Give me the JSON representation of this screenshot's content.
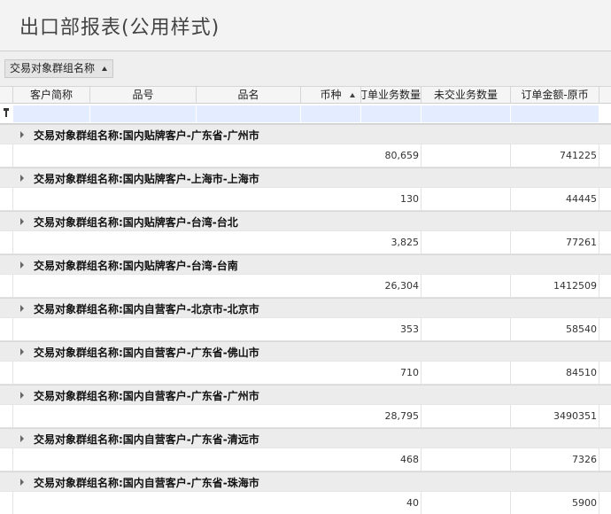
{
  "report": {
    "title": "出口部报表(公用样式)"
  },
  "group_panel": {
    "chip_label": "交易对象群组名称"
  },
  "columns": [
    "客户简称",
    "品号",
    "品名",
    "币种",
    "订单业务数量",
    "未交业务数量",
    "订单金额-原币"
  ],
  "groups": [
    {
      "label": "交易对象群组名称:国内贴牌客户-广东省-广州市",
      "order_qty": "80,659",
      "amount": "741225"
    },
    {
      "label": "交易对象群组名称:国内贴牌客户-上海市-上海市",
      "order_qty": "130",
      "amount": "44445"
    },
    {
      "label": "交易对象群组名称:国内贴牌客户-台湾-台北",
      "order_qty": "3,825",
      "amount": "77261"
    },
    {
      "label": "交易对象群组名称:国内贴牌客户-台湾-台南",
      "order_qty": "26,304",
      "amount": "1412509"
    },
    {
      "label": "交易对象群组名称:国内自营客户-北京市-北京市",
      "order_qty": "353",
      "amount": "58540"
    },
    {
      "label": "交易对象群组名称:国内自营客户-广东省-佛山市",
      "order_qty": "710",
      "amount": "84510"
    },
    {
      "label": "交易对象群组名称:国内自营客户-广东省-广州市",
      "order_qty": "28,795",
      "amount": "3490351"
    },
    {
      "label": "交易对象群组名称:国内自营客户-广东省-清远市",
      "order_qty": "468",
      "amount": "7326"
    },
    {
      "label": "交易对象群组名称:国内自营客户-广东省-珠海市",
      "order_qty": "40",
      "amount": "5900"
    }
  ]
}
